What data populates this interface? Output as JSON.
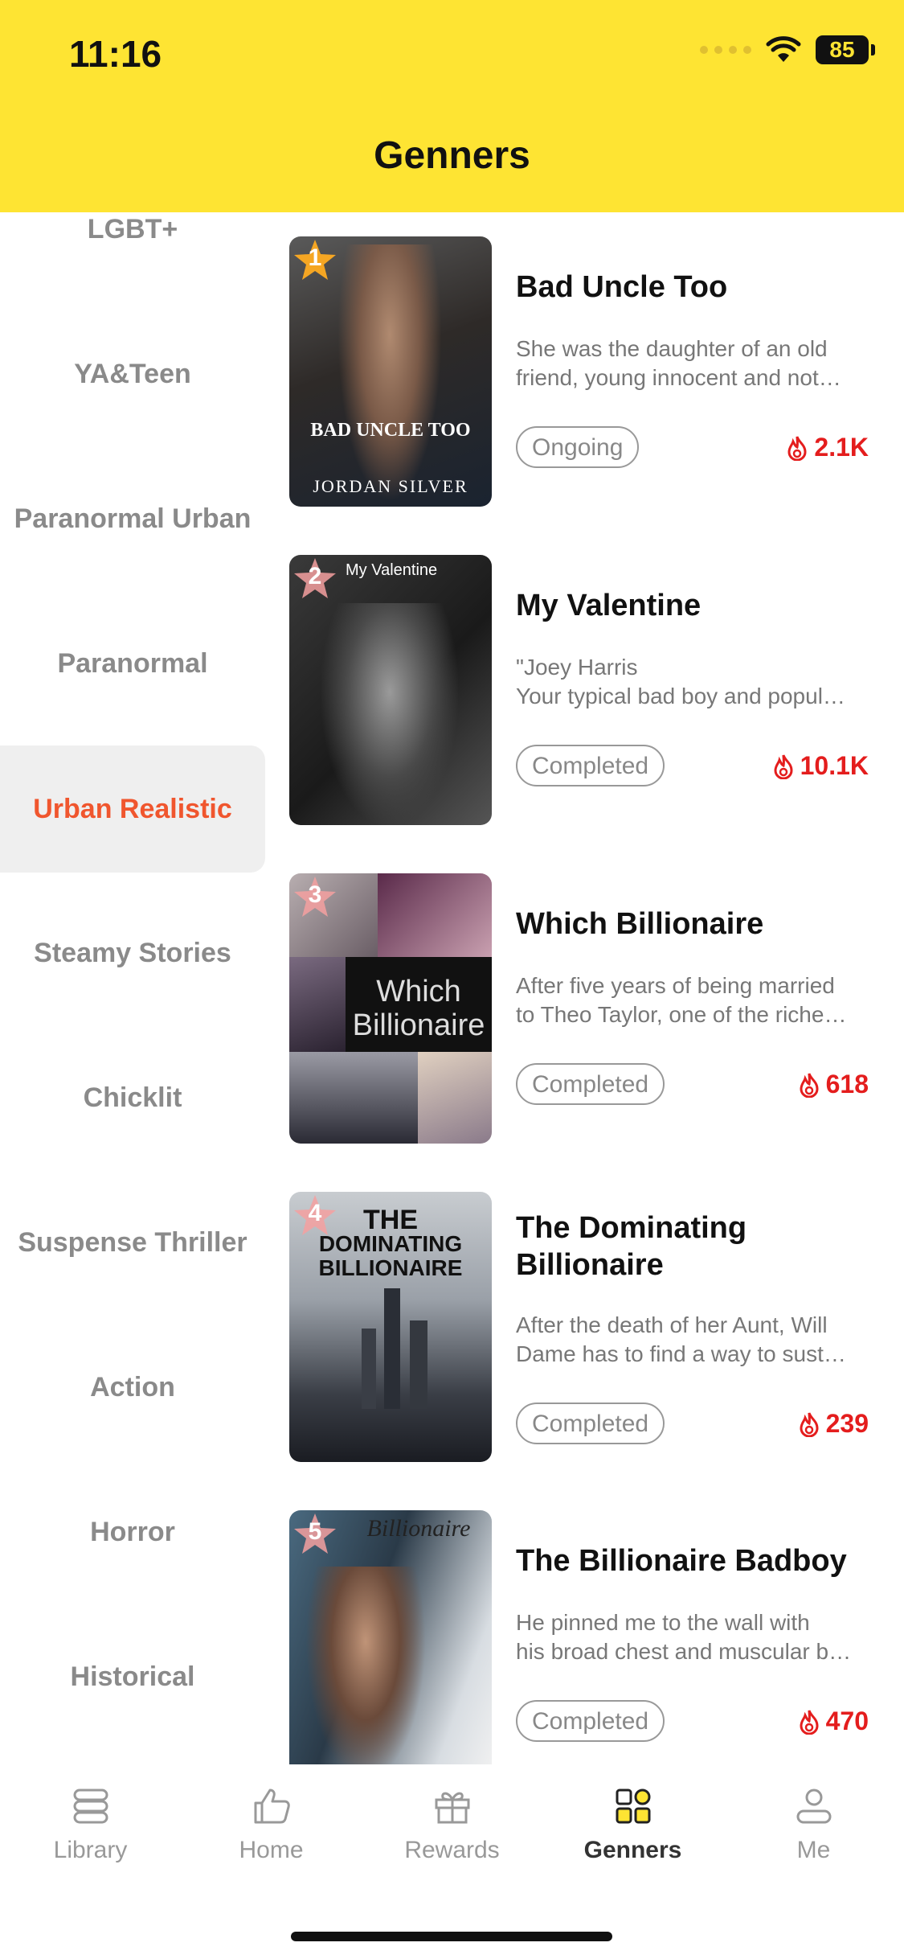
{
  "colors": {
    "accent": "#FEE433",
    "active_category": "#F0562E",
    "heat": "#E41D1D"
  },
  "status_bar": {
    "time": "11:16",
    "battery": "85"
  },
  "header": {
    "title": "Genners"
  },
  "categories": [
    {
      "label": "LGBT+"
    },
    {
      "label": "YA&Teen"
    },
    {
      "label": "Paranormal Urban"
    },
    {
      "label": "Paranormal"
    },
    {
      "label": "Urban Realistic",
      "active": true
    },
    {
      "label": "Steamy Stories"
    },
    {
      "label": "Chicklit"
    },
    {
      "label": "Suspense Thriller"
    },
    {
      "label": "Action"
    },
    {
      "label": "Horror"
    },
    {
      "label": "Historical"
    }
  ],
  "books": [
    {
      "rank": "1",
      "title_lines": [
        "Bad Uncle Too"
      ],
      "desc_lines": [
        "She was the daughter of an old",
        "friend, young innocent and not…"
      ],
      "status": "Ongoing",
      "heat": "2.1K",
      "cover_text": [
        "BAD UNCLE TOO",
        "JORDAN SILVER"
      ]
    },
    {
      "rank": "2",
      "title_lines": [
        "My Valentine"
      ],
      "desc_lines": [
        "\"Joey Harris",
        "Your typical bad boy and popul…"
      ],
      "status": "Completed",
      "heat": "10.1K",
      "cover_text": [
        "My Valentine"
      ]
    },
    {
      "rank": "3",
      "title_lines": [
        "Which Billionaire"
      ],
      "desc_lines": [
        "After five years of being married",
        "to Theo Taylor, one of the riche…"
      ],
      "status": "Completed",
      "heat": "618",
      "cover_text": [
        "Which",
        "Billionaire"
      ]
    },
    {
      "rank": "4",
      "title_lines": [
        "The Dominating",
        "Billionaire"
      ],
      "desc_lines": [
        "After the death of her Aunt, Will",
        "Dame has to find a way to sust…"
      ],
      "status": "Completed",
      "heat": "239",
      "cover_text": [
        "THE",
        "DOMINATING",
        "BILLIONAIRE"
      ]
    },
    {
      "rank": "5",
      "title_lines": [
        "The Billionaire Badboy"
      ],
      "desc_lines": [
        "He pinned me to the wall with",
        "his broad chest and muscular b…"
      ],
      "status": "Completed",
      "heat": "470",
      "cover_text": [
        "Billionaire"
      ]
    }
  ],
  "tabs": [
    {
      "label": "Library",
      "icon": "library-icon"
    },
    {
      "label": "Home",
      "icon": "thumbs-up-icon"
    },
    {
      "label": "Rewards",
      "icon": "gift-icon"
    },
    {
      "label": "Genners",
      "icon": "genres-grid-icon",
      "active": true
    },
    {
      "label": "Me",
      "icon": "person-icon"
    }
  ]
}
